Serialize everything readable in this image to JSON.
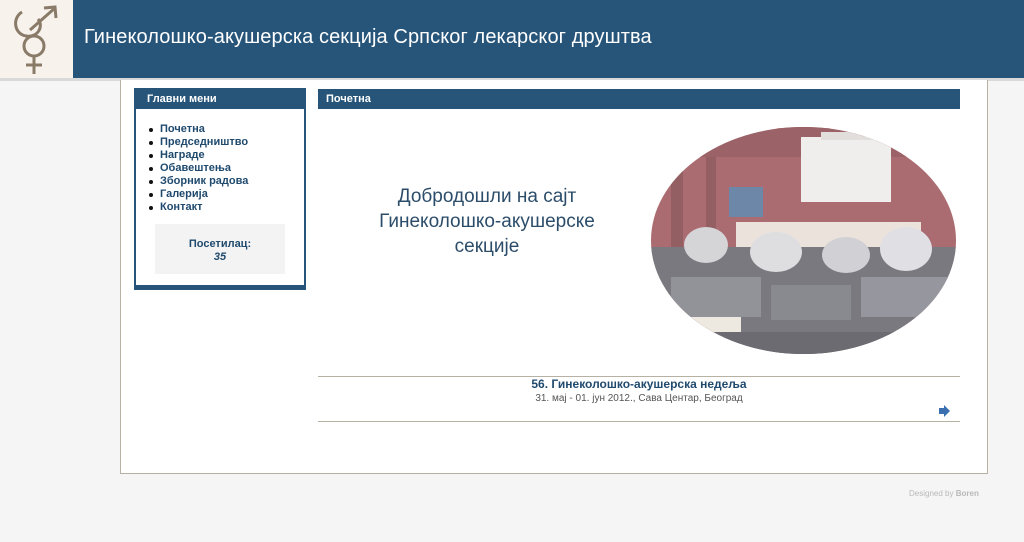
{
  "header": {
    "title": "Гинеколошко-акушерска секција Српског лекарског друштва"
  },
  "sidebar": {
    "title": "Главни мени",
    "items": [
      {
        "label": "Почетна"
      },
      {
        "label": "Председништво"
      },
      {
        "label": "Награде"
      },
      {
        "label": "Обавештења"
      },
      {
        "label": "Зборник радова"
      },
      {
        "label": "Галерија"
      },
      {
        "label": "Контакт"
      }
    ],
    "visitors_label": "Посетилац:",
    "visitors_count": "35"
  },
  "main": {
    "title": "Почетна",
    "welcome": "Добродошли на сајт Гинеколошко-акушерске секције",
    "event_title": "56. Гинеколошко-акушерска недеља",
    "event_subtitle": "31. мај - 01. јун 2012., Сава Центар, Београд"
  },
  "footer": {
    "designed_by": "Designed by",
    "designer": "Boren"
  },
  "colors": {
    "primary": "#27557a",
    "link": "#1f4a6e",
    "border": "#b7b1a4"
  },
  "icons": {
    "logo": "gender-symbol-logo",
    "more": "arrow-right-icon"
  }
}
